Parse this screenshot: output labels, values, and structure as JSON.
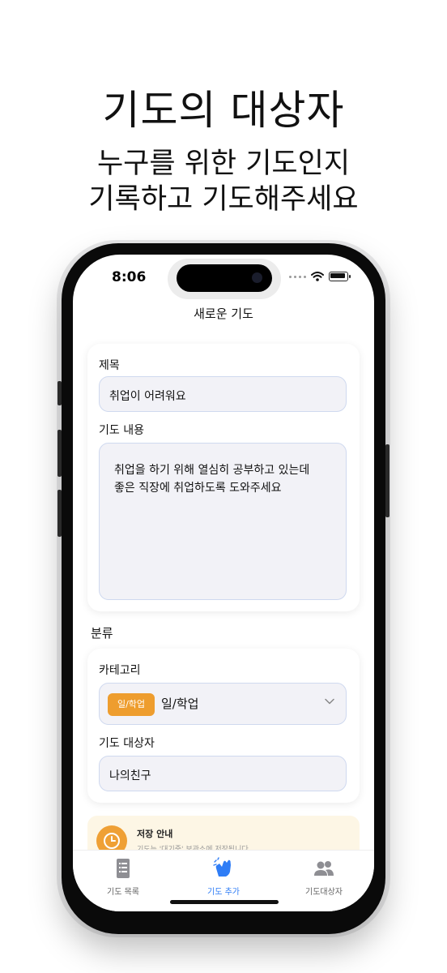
{
  "headline": {
    "title": "기도의 대상자",
    "subtitle_line1": "누구를 위한 기도인지",
    "subtitle_line2": "기록하고 기도해주세요"
  },
  "status_bar": {
    "time": "8:06",
    "icons": [
      "wifi-icon",
      "battery-icon"
    ]
  },
  "nav": {
    "title": "새로운 기도"
  },
  "form": {
    "title_label": "제목",
    "title_value": "취업이 어려워요",
    "content_label": "기도 내용",
    "content_value": "취업을 하기 위해 열심히 공부하고 있는데\n좋은 직장에 취업하도록 도와주세요"
  },
  "classification": {
    "section_label": "분류",
    "category_label": "카테고리",
    "category_chip": "일/학업",
    "category_value": "일/학업",
    "target_label": "기도 대상자",
    "target_value": "나의친구"
  },
  "notice": {
    "title": "저장 안내",
    "text": "기도는 '대기중' 보관소에 저장됩니다"
  },
  "tabs": [
    {
      "label": "기도 목록",
      "icon": "list-icon",
      "active": false
    },
    {
      "label": "기도 추가",
      "icon": "praying-hands-icon",
      "active": true
    },
    {
      "label": "기도대상자",
      "icon": "people-icon",
      "active": false
    }
  ],
  "colors": {
    "accent": "#2f7df6",
    "chip": "#ee9d2e",
    "notice_bg": "#fdf6e5",
    "field_bg": "#f2f2f7"
  }
}
